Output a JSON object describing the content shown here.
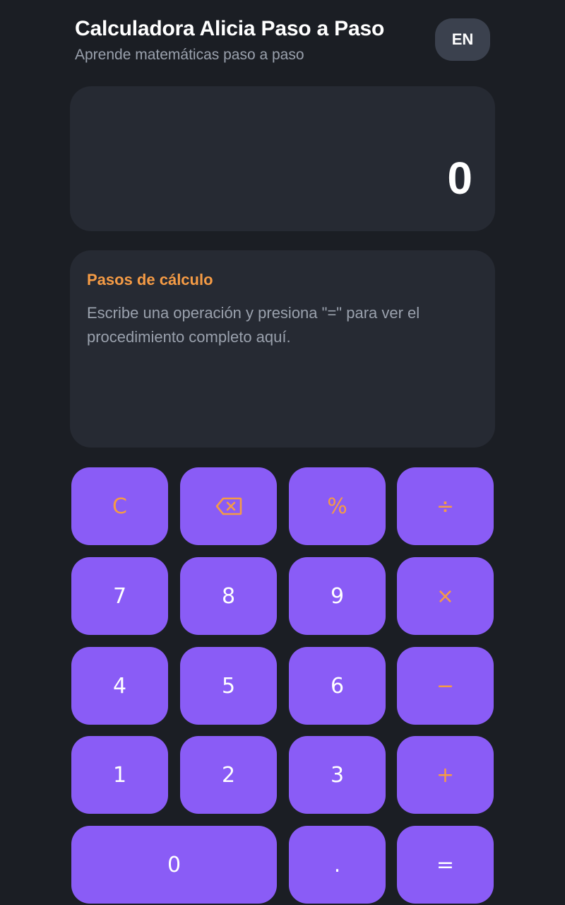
{
  "header": {
    "title": "Calculadora Alicia Paso a Paso",
    "subtitle": "Aprende matemáticas paso a paso",
    "lang_label": "EN"
  },
  "display": {
    "value": "0"
  },
  "steps": {
    "title": "Pasos de cálculo",
    "placeholder": "Escribe una operación y presiona \"=\" para ver el procedimiento completo aquí."
  },
  "keypad": {
    "clear": "C",
    "backspace_icon": "backspace-icon",
    "percent": "%",
    "divide": "÷",
    "seven": "7",
    "eight": "8",
    "nine": "9",
    "multiply": "×",
    "four": "4",
    "five": "5",
    "six": "6",
    "minus": "−",
    "one": "1",
    "two": "2",
    "three": "3",
    "plus": "+",
    "zero": "0",
    "decimal": ".",
    "equals": "="
  },
  "colors": {
    "background": "#1b1e24",
    "panel": "#262a33",
    "key": "#8a5cf6",
    "accent": "#f59b45",
    "lang_button": "#3b414e"
  }
}
